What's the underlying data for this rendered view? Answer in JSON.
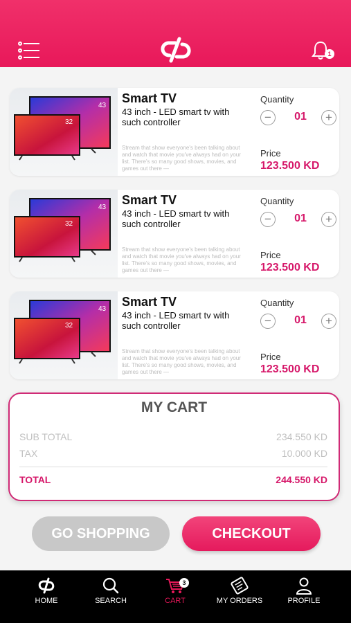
{
  "header": {
    "menu_icon": "menu-icon",
    "logo_icon": "link-logo-icon",
    "bell_icon": "bell-icon",
    "notification_count": "1"
  },
  "cart_items": [
    {
      "title": "Smart TV",
      "subtitle": "43 inch - LED smart tv with such controller",
      "description": "Stream that show everyone's been talking about and watch that movie you've always had on your list. There's so many good shows, movies, and games out there —",
      "quantity_label": "Quantity",
      "quantity": "01",
      "price_label": "Price",
      "price": "123.500 KD",
      "tv_sizes": [
        "43",
        "32"
      ]
    },
    {
      "title": "Smart TV",
      "subtitle": "43 inch - LED smart tv with such controller",
      "description": "Stream that show everyone's been talking about and watch that movie you've always had on your list. There's so many good shows, movies, and games out there —",
      "quantity_label": "Quantity",
      "quantity": "01",
      "price_label": "Price",
      "price": "123.500 KD",
      "tv_sizes": [
        "43",
        "32"
      ]
    },
    {
      "title": "Smart TV",
      "subtitle": "43 inch - LED smart tv with such controller",
      "description": "Stream that show everyone's been talking about and watch that movie you've always had on your list. There's so many good shows, movies, and games out there —",
      "quantity_label": "Quantity",
      "quantity": "01",
      "price_label": "Price",
      "price": "123.500 KD",
      "tv_sizes": [
        "43",
        "32"
      ]
    }
  ],
  "summary": {
    "title": "MY CART",
    "subtotal_label": "SUB TOTAL",
    "subtotal_value": "234.550 KD",
    "tax_label": "TAX",
    "tax_value": "10.000 KD",
    "total_label": "TOTAL",
    "total_value": "244.550 KD"
  },
  "actions": {
    "go_shopping_label": "GO SHOPPING",
    "checkout_label": "CHECKOUT"
  },
  "tabs": [
    {
      "label": "HOME",
      "icon": "home-logo-icon"
    },
    {
      "label": "SEARCH",
      "icon": "search-icon"
    },
    {
      "label": "CART",
      "icon": "cart-icon",
      "badge": "3",
      "active": true
    },
    {
      "label": "MY ORDERS",
      "icon": "orders-icon"
    },
    {
      "label": "PROFILE",
      "icon": "profile-icon"
    }
  ],
  "colors": {
    "brand_pink": "#e8185a",
    "price_magenta": "#d6186a",
    "muted_gray": "#c8c8c8",
    "tabbar_black": "#000000"
  }
}
